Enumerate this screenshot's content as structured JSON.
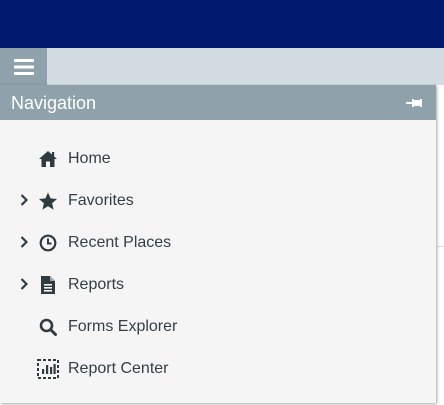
{
  "panel": {
    "title": "Navigation",
    "pin_icon": "pin-icon",
    "menu_icon": "hamburger-menu-icon"
  },
  "colors": {
    "top_bar": "#021a6e",
    "header": "#8fa1ab",
    "panel_bg": "#f5f5f5",
    "icon": "#2f3b40",
    "text": "#333f44"
  },
  "nav_items": [
    {
      "label": "Home",
      "icon": "home-icon",
      "expandable": false
    },
    {
      "label": "Favorites",
      "icon": "star-icon",
      "expandable": true
    },
    {
      "label": "Recent Places",
      "icon": "clock-icon",
      "expandable": true
    },
    {
      "label": "Reports",
      "icon": "document-icon",
      "expandable": true
    },
    {
      "label": "Forms Explorer",
      "icon": "search-icon",
      "expandable": false
    },
    {
      "label": "Report Center",
      "icon": "report-center-icon",
      "expandable": false
    }
  ]
}
